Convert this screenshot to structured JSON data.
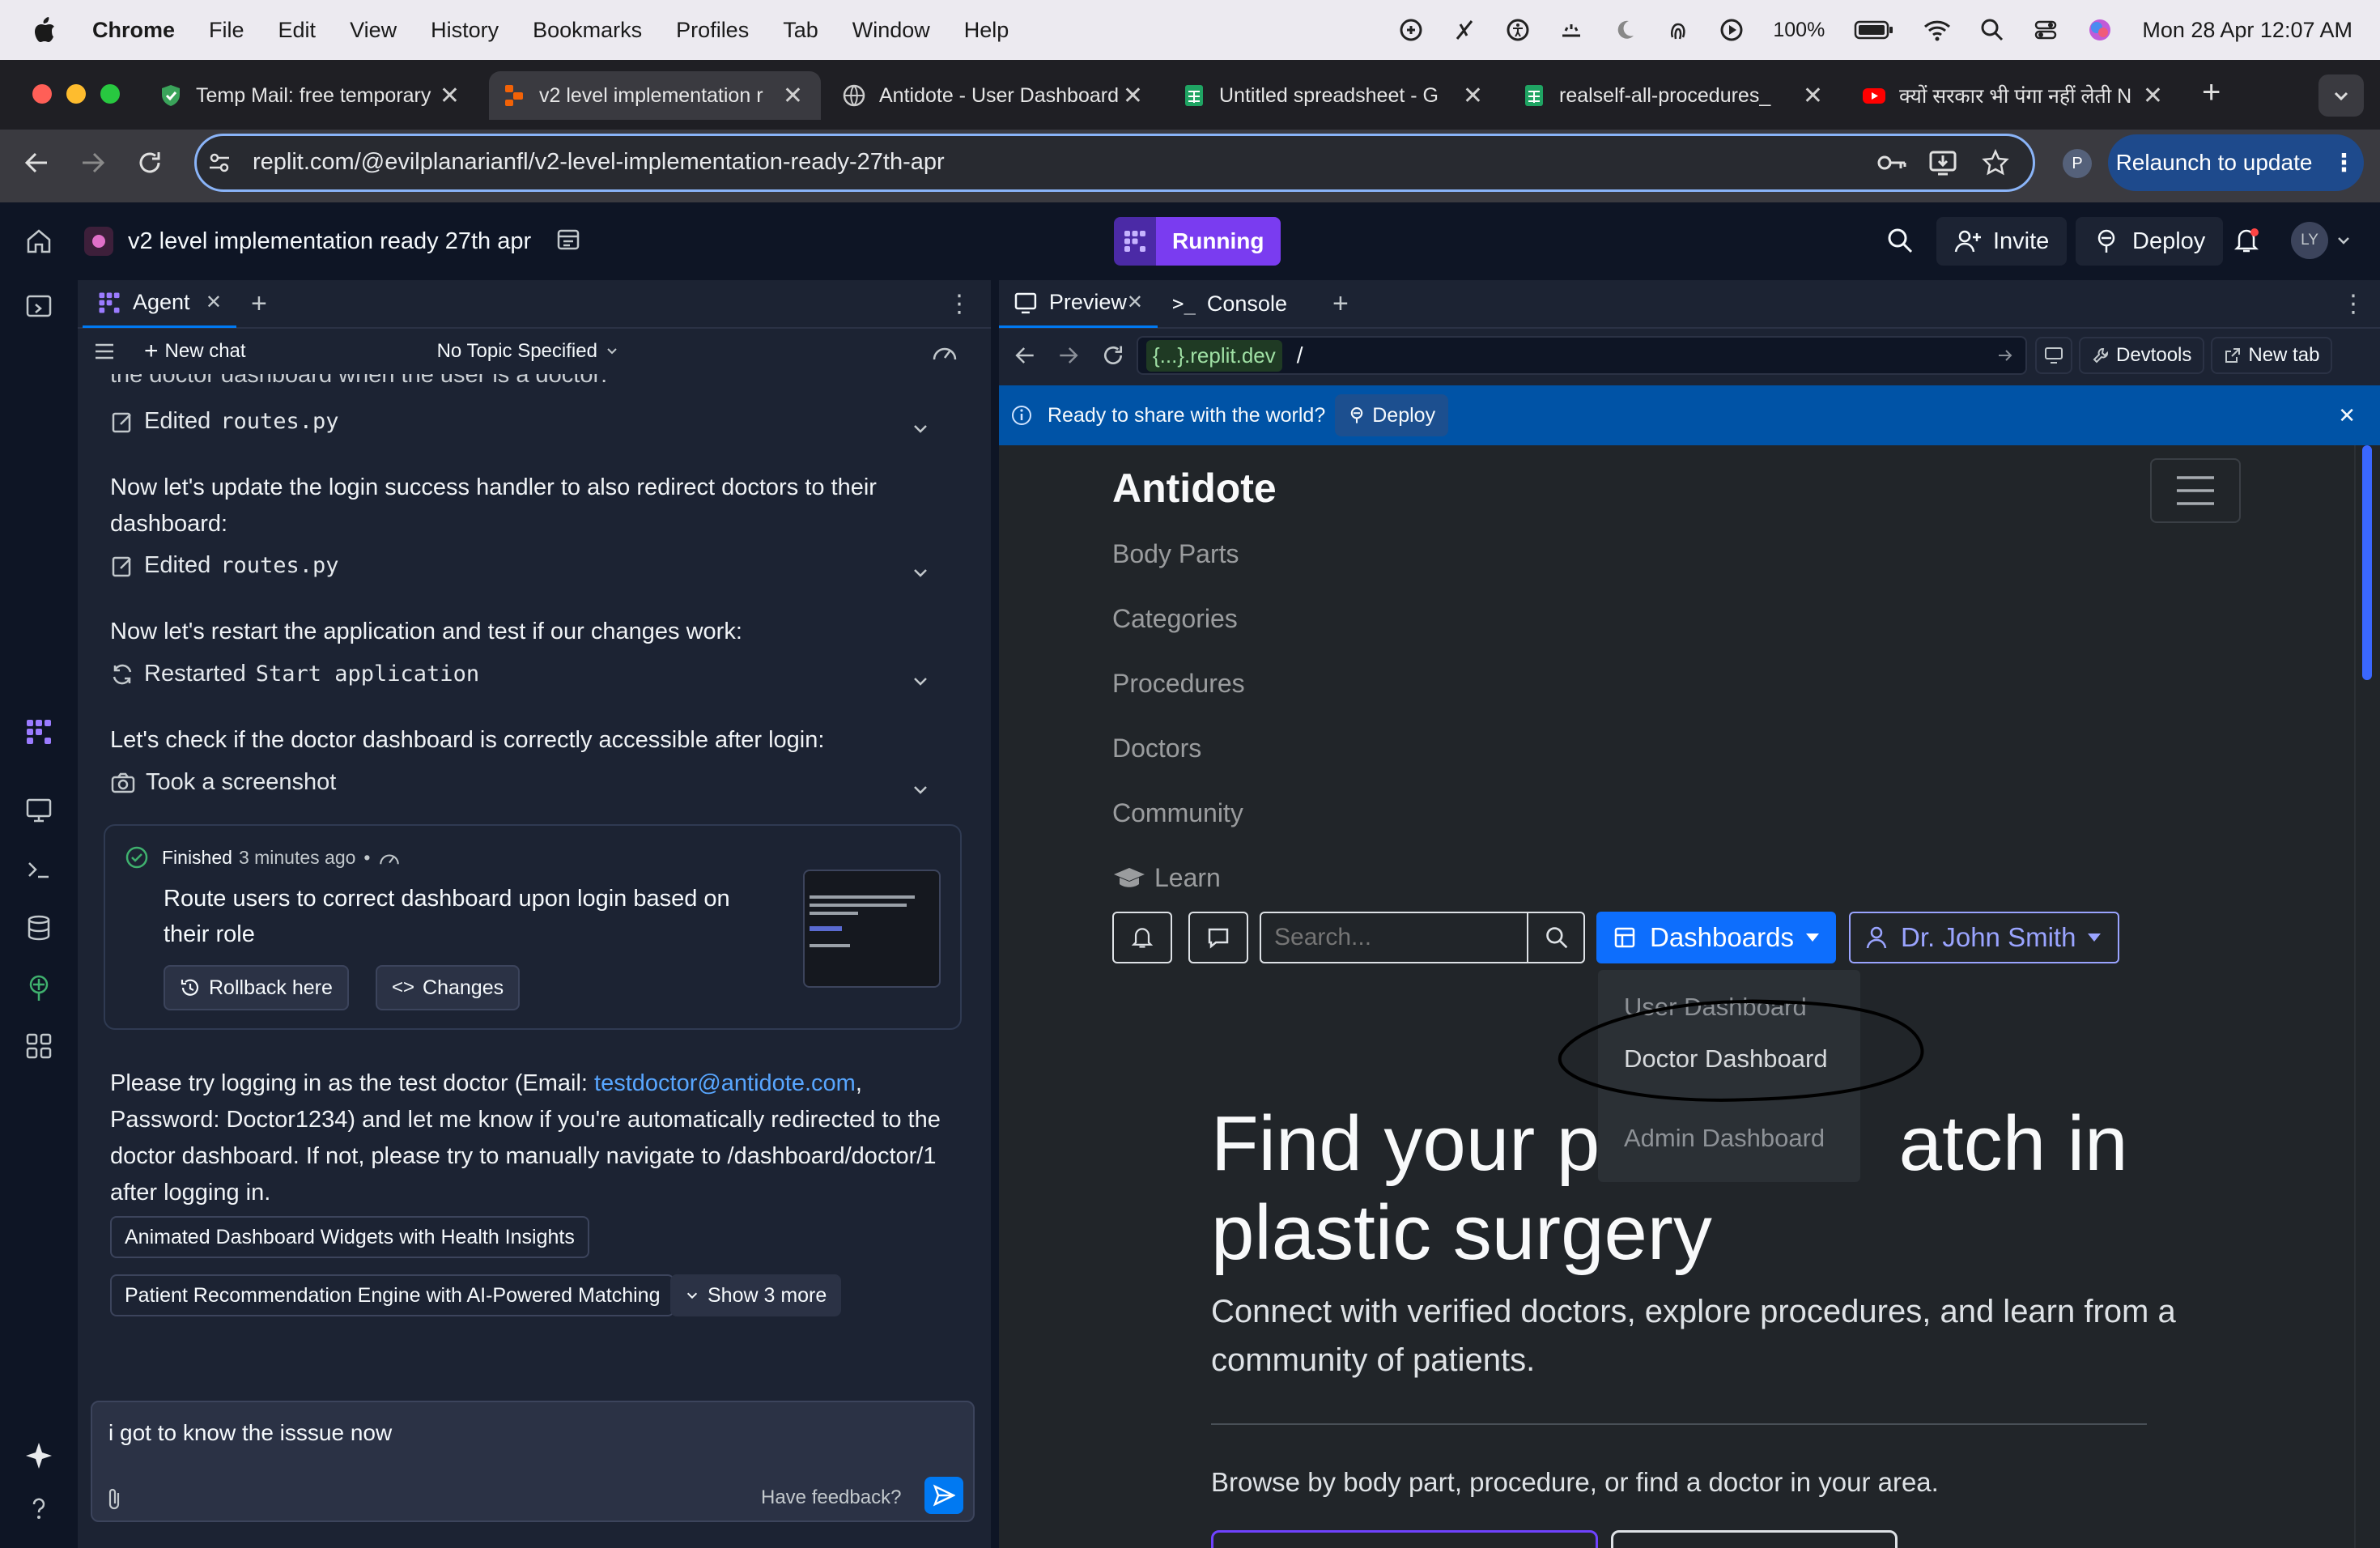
{
  "menubar": {
    "app": "Chrome",
    "menus": [
      "File",
      "Edit",
      "View",
      "History",
      "Bookmarks",
      "Profiles",
      "Tab",
      "Window",
      "Help"
    ],
    "battery": "100%",
    "clock": "Mon 28 Apr  12:07 AM"
  },
  "browser": {
    "tabs": [
      {
        "title": "Temp Mail: free temporary",
        "favicon": "shield-icon"
      },
      {
        "title": "v2 level implementation r",
        "favicon": "replit-icon",
        "active": true
      },
      {
        "title": "Antidote - User Dashboard",
        "favicon": "globe-icon"
      },
      {
        "title": "Untitled spreadsheet - G",
        "favicon": "sheets-icon"
      },
      {
        "title": "realself-all-procedures_",
        "favicon": "sheets-icon"
      },
      {
        "title": "क्यों सरकार भी पंगा नहीं लेती N",
        "favicon": "youtube-icon"
      }
    ],
    "url": "replit.com/@evilplanarianfl/v2-level-implementation-ready-27th-apr",
    "profile": "P",
    "relaunch": "Relaunch to update"
  },
  "replit": {
    "project_title": "v2 level implementation ready 27th apr",
    "status": "Running",
    "invite": "Invite",
    "deploy": "Deploy",
    "avatar": "LY"
  },
  "agent": {
    "tab": "Agent",
    "new_chat": "New chat",
    "topic": "No Topic Specified",
    "cut_line": "the doctor dashboard when the user is a doctor:",
    "step1_label": "Edited",
    "step1_file": "routes.py",
    "para1": "Now let's update the login success handler to also redirect doctors to their dashboard:",
    "step2_label": "Edited",
    "step2_file": "routes.py",
    "para2": "Now let's restart the application and test if our changes work:",
    "step3_label": "Restarted",
    "step3_file": "Start application",
    "para3": "Let's check if the doctor dashboard is correctly accessible after login:",
    "step4_label": "Took a screenshot",
    "finished_label": "Finished",
    "finished_time": "3 minutes ago",
    "finished_bullet": "•",
    "finished_text": "Route users to correct dashboard upon login based on their role",
    "rollback": "Rollback here",
    "changes": "Changes",
    "msg_part1": "Please try logging in as the test doctor (Email: ",
    "msg_email": "testdoctor@antidote.com",
    "msg_part2": ", Password: Doctor1234) and let me know if you're automatically redirected to the doctor dashboard. If not, please try to manually navigate to /dashboard/doctor/1 after logging in.",
    "suggestion1": "Animated Dashboard Widgets with Health Insights",
    "suggestion2": "Patient Recommendation Engine with AI-Powered Matching",
    "show_more": "Show 3 more",
    "input_value": "i got to know the isssue now",
    "feedback": "Have feedback?"
  },
  "preview": {
    "tab_preview": "Preview",
    "tab_console": "Console",
    "domain": "{...}.replit.dev",
    "path": "/",
    "devtools": "Devtools",
    "new_tab": "New tab",
    "banner_text": "Ready to share with the world?",
    "banner_deploy": "Deploy"
  },
  "site": {
    "brand": "Antidote",
    "nav": [
      "Body Parts",
      "Categories",
      "Procedures",
      "Doctors",
      "Community",
      "Learn"
    ],
    "search_placeholder": "Search...",
    "dashboards": "Dashboards",
    "user": "Dr. John Smith",
    "dropdown": [
      "User Dashboard",
      "Doctor Dashboard",
      "Admin Dashboard"
    ],
    "hero_left": "Find your pe",
    "hero_right": "atch in",
    "hero_line2": "plastic surgery",
    "subtitle": "Connect with verified doctors, explore procedures, and learn from a community of patients.",
    "browse": "Browse by body part, procedure, or find a doctor in your area."
  },
  "colors": {
    "replit_bg": "#0e1525",
    "panel_bg": "#1c2333",
    "site_bg": "#212529",
    "running_purple": "#7a3cf0",
    "deploy_blue": "#0053a6",
    "link_blue": "#58a6ff"
  }
}
